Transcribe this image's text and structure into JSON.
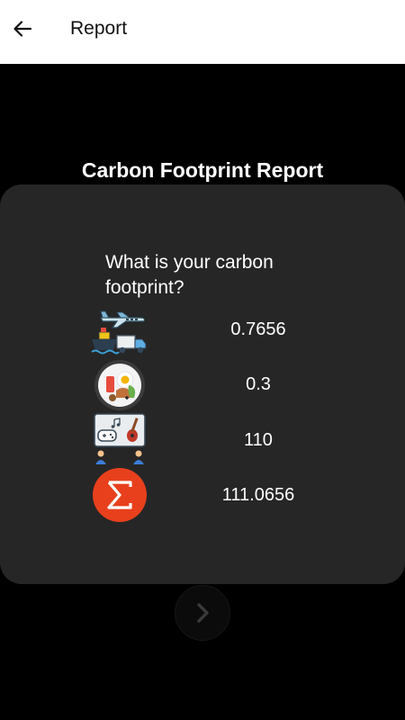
{
  "appbar": {
    "title": "Report",
    "back_icon": "arrow-left-icon"
  },
  "page_title": "Carbon Footprint Report",
  "question": "What is your carbon footprint?",
  "rows": [
    {
      "icon": "transport-icon",
      "value": "0.7656"
    },
    {
      "icon": "food-icon",
      "value": "0.3"
    },
    {
      "icon": "entertainment-icon",
      "value": "110"
    },
    {
      "icon": "sigma-total-icon",
      "value": "111.0656"
    }
  ],
  "next_icon": "chevron-right-icon",
  "colors": {
    "background": "#000000",
    "card": "#262626",
    "appbar": "#ffffff",
    "sigma": "#e8401c"
  }
}
